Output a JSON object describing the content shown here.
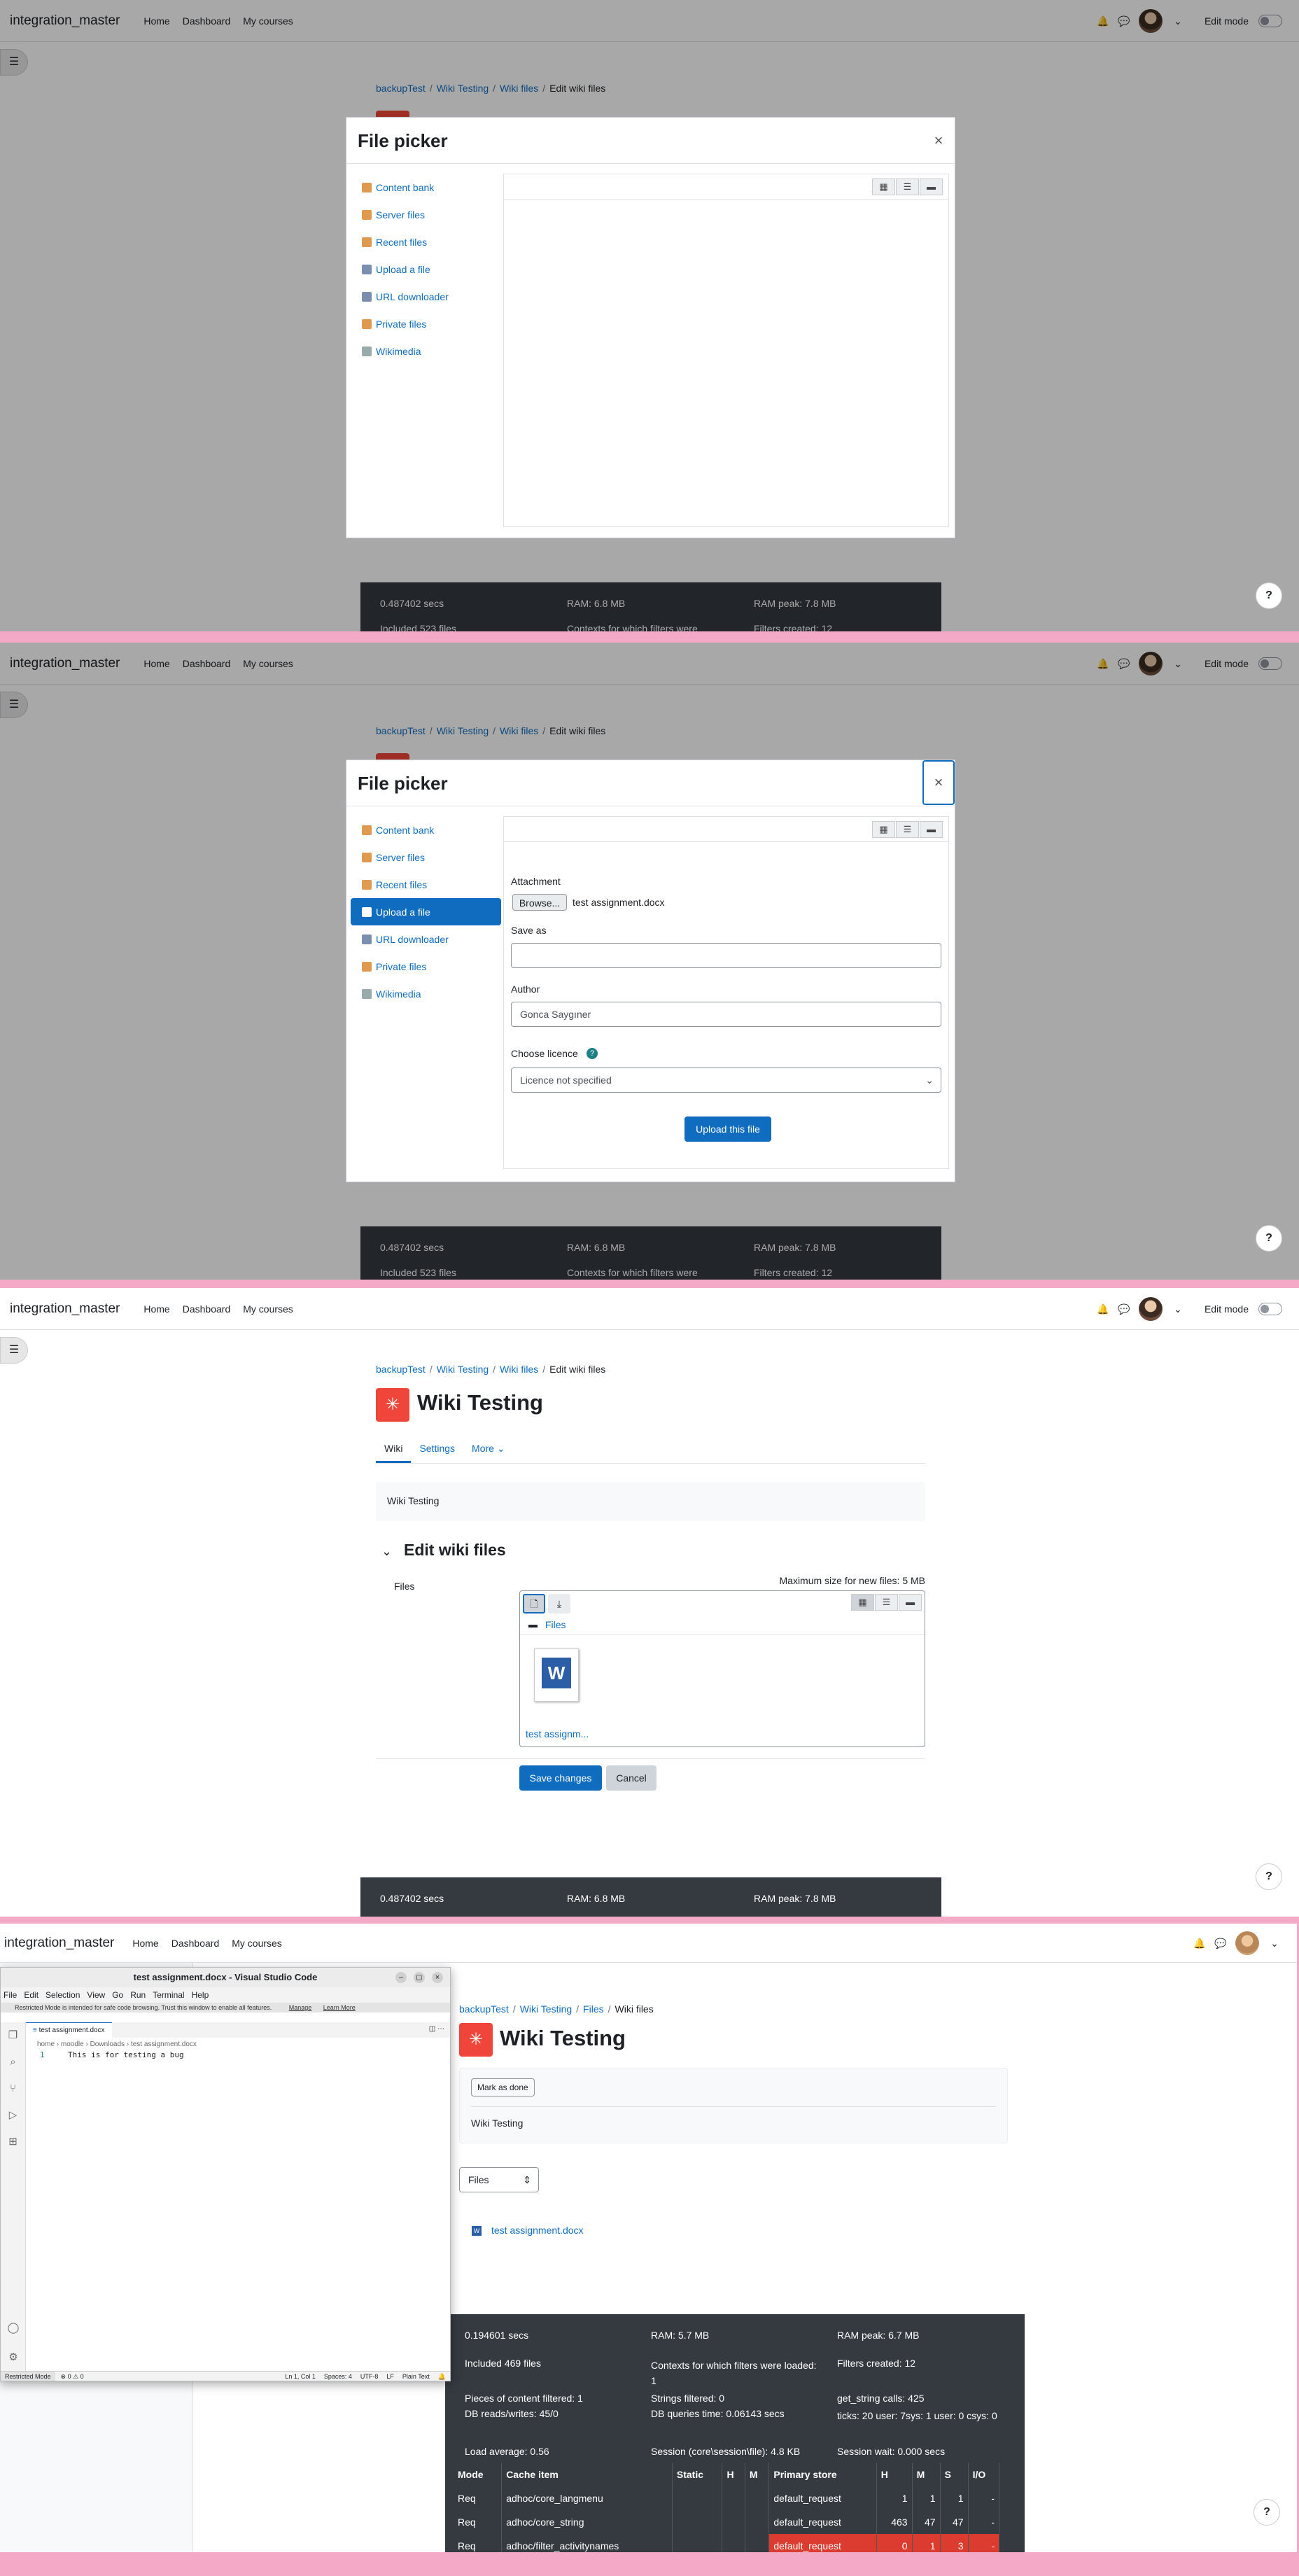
{
  "nav": {
    "brand": "integration_master",
    "links": [
      "Home",
      "Dashboard",
      "My courses"
    ],
    "edit_mode": "Edit mode"
  },
  "breadcrumb_edit": [
    "backupTest",
    "Wiki Testing",
    "Wiki files",
    "Edit wiki files"
  ],
  "breadcrumb_view": [
    "backupTest",
    "Wiki Testing",
    "Files",
    "Wiki files"
  ],
  "file_picker": {
    "title": "File picker",
    "close": "×",
    "repositories": [
      "Content bank",
      "Server files",
      "Recent files",
      "Upload a file",
      "URL downloader",
      "Private files",
      "Wikimedia"
    ],
    "active_repository": "Upload a file",
    "attachment_label": "Attachment",
    "browse_label": "Browse...",
    "chosen_file": "test assignment.docx",
    "save_as_label": "Save as",
    "save_as_value": "",
    "author_label": "Author",
    "author_value": "Gonca Saygıner",
    "licence_label": "Choose licence",
    "licence_value": "Licence not specified",
    "upload_button": "Upload this file"
  },
  "footer": {
    "time": "0.487402 secs",
    "ram": "RAM: 6.8 MB",
    "ram_peak": "RAM peak: 7.8 MB",
    "included": "Included 523 files",
    "contexts": "Contexts for which filters were",
    "filters": "Filters created: 12"
  },
  "wiki": {
    "title": "Wiki Testing",
    "tabs": [
      "Wiki",
      "Settings",
      "More"
    ],
    "description": "Wiki Testing",
    "section_title": "Edit wiki files",
    "files_label": "Files",
    "max_size": "Maximum size for new files: 5 MB",
    "folder_path": "Files",
    "file_name": "test assignm...",
    "save_button": "Save changes",
    "cancel_button": "Cancel"
  },
  "vscode": {
    "title": "test assignment.docx - Visual Studio Code",
    "menu": [
      "File",
      "Edit",
      "Selection",
      "View",
      "Go",
      "Run",
      "Terminal",
      "Help"
    ],
    "warning": "Restricted Mode is intended for safe code browsing. Trust this window to enable all features.",
    "warning_manage": "Manage",
    "warning_learn": "Learn More",
    "tab": "test assignment.docx",
    "breadcrumb": "home › moodle › Downloads › test assignment.docx",
    "line_number": "1",
    "line_text": "This is for testing a bug",
    "status_left": "Restricted Mode",
    "status_problems": "⊗ 0 ⚠ 0",
    "status_right": [
      "Ln 1, Col 1",
      "Spaces: 4",
      "UTF-8",
      "LF",
      "Plain Text"
    ]
  },
  "wiki_view": {
    "mark_done": "Mark as done",
    "description": "Wiki Testing",
    "select": "Files",
    "file_link": "test assignment.docx"
  },
  "perf": {
    "time": "0.194601 secs",
    "ram": "RAM: 5.7 MB",
    "ram_peak": "RAM peak: 6.7 MB",
    "included": "Included 469 files",
    "contexts": "Contexts for which filters were loaded: 1",
    "filters": "Filters created: 12",
    "pieces": "Pieces of content filtered: 1",
    "strings": "Strings filtered: 0",
    "get_string": "get_string calls: 425",
    "db_rw": "DB reads/writes: 45/0",
    "db_time": "DB queries time: 0.06143 secs",
    "ticks": "ticks: 20 user: 7sys: 1 user: 0 csys: 0",
    "load": "Load average: 0.56",
    "session": "Session (core\\session\\file): 4.8 KB",
    "session_wait": "Session wait: 0.000 secs",
    "table_headers": [
      "Mode",
      "Cache item",
      "Static",
      "H",
      "M",
      "Primary store",
      "H",
      "M",
      "S",
      "I/O"
    ],
    "rows": [
      [
        "Req",
        "adhoc/core_langmenu",
        "",
        "",
        "",
        "default_request",
        "1",
        "1",
        "1",
        "-"
      ],
      [
        "Req",
        "adhoc/core_string",
        "",
        "",
        "",
        "default_request",
        "463",
        "47",
        "47",
        "-"
      ],
      [
        "Req",
        "adhoc/filter_activitynames",
        "",
        "",
        "",
        "default_request",
        "0",
        "1",
        "3",
        "-"
      ]
    ]
  },
  "help": "?"
}
